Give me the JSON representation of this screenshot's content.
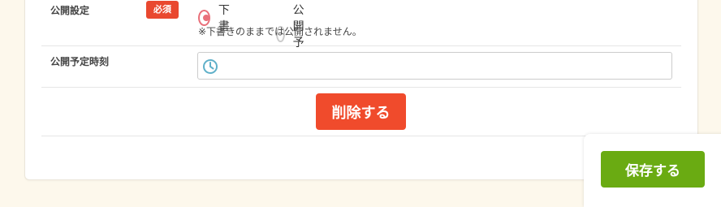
{
  "publish_setting": {
    "label": "公開設定",
    "required_badge": "必須",
    "options": [
      {
        "label": "下書",
        "checked": true
      },
      {
        "label": "公開予定",
        "checked": false
      }
    ],
    "note": "※下書きのままでは公開されません。"
  },
  "scheduled_time": {
    "label": "公開予定時刻",
    "value": "",
    "icon": "clock-icon"
  },
  "actions": {
    "delete_label": "削除する",
    "save_label": "保存する"
  },
  "colors": {
    "badge": "#e9482f",
    "radio_checked": "#e9707a",
    "delete_button": "#f04b2c",
    "save_button": "#6aab12",
    "clock_icon": "#5fb0c9",
    "page_background": "#fdf8ec"
  }
}
